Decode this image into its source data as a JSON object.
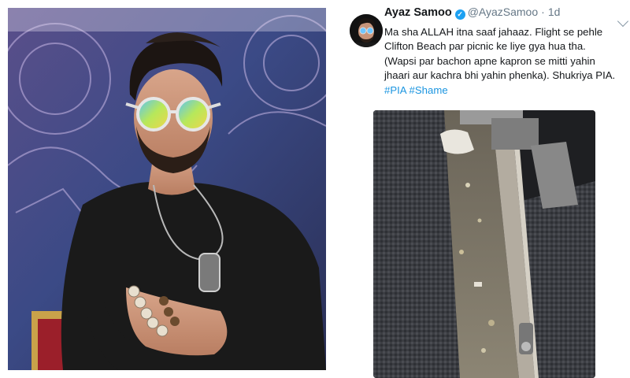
{
  "tweet": {
    "display_name": "Ayaz Samoo",
    "verified_icon": "verified-badge-icon",
    "handle": "@AyazSamoo",
    "separator": "·",
    "time": "1d",
    "text_main": "Ma sha ALLAH itna saaf jahaaz. Flight se pehle Clifton Beach par picnic ke liye gya hua tha. (Wapsi par bachon apne kapron se mitti yahin jhaari aur kachra bhi yahin phenka). Shukriya PIA.",
    "hashtag_1": "#PIA",
    "hashtag_2": "#Shame",
    "menu_icon": "chevron-down-icon",
    "link_color": "#1b95e0"
  }
}
